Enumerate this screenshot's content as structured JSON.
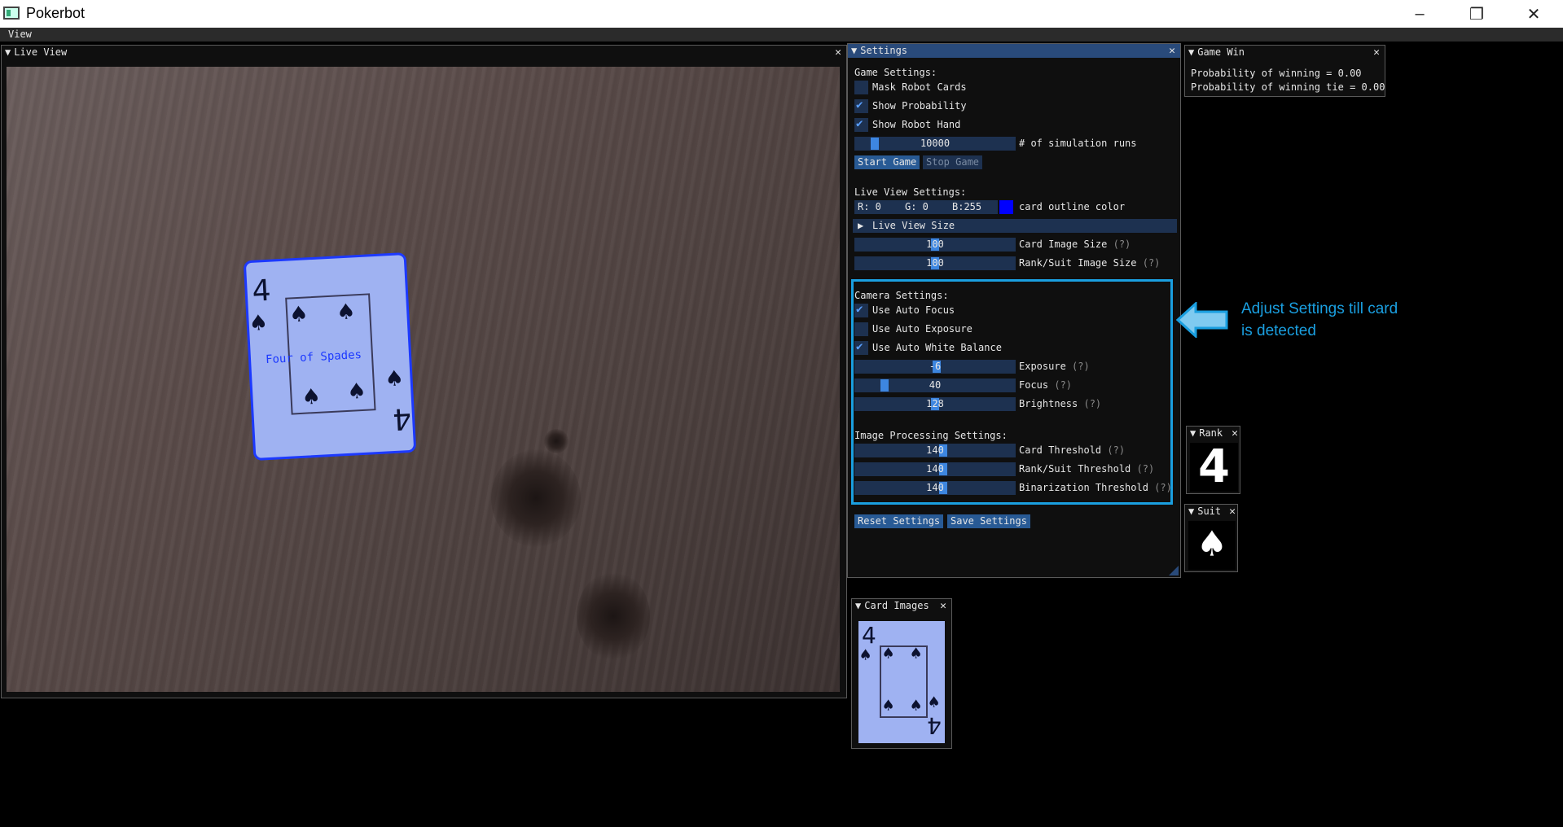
{
  "window": {
    "title": "Pokerbot",
    "minimize": "–",
    "restore": "❐",
    "close": "✕"
  },
  "menu": {
    "view": "View"
  },
  "live_view": {
    "title": "Live View",
    "overlay_text": "Four of Spades"
  },
  "settings": {
    "title": "Settings",
    "game_settings_label": "Game Settings:",
    "mask_robot_cards": {
      "label": "Mask Robot Cards",
      "checked": false
    },
    "show_probability": {
      "label": "Show Probability",
      "checked": true
    },
    "show_robot_hand": {
      "label": "Show Robot Hand",
      "checked": true
    },
    "simulation_runs": {
      "value": "10000",
      "label": "# of simulation runs"
    },
    "start_game": "Start Game",
    "stop_game": "Stop Game",
    "live_view_settings_label": "Live View Settings:",
    "color_r": "R:  0",
    "color_g": "G:  0",
    "color_b": "B:255",
    "card_outline_color_label": "card outline color",
    "outline_color": "#0000ff",
    "live_view_size_header": "Live View Size",
    "card_image_size": {
      "value": "100",
      "label": "Card Image Size",
      "help": "(?)"
    },
    "rank_suit_image_size": {
      "value": "100",
      "label": "Rank/Suit Image Size",
      "help": "(?)"
    },
    "camera_settings_label": "Camera Settings:",
    "use_auto_focus": {
      "label": "Use Auto Focus",
      "checked": true
    },
    "use_auto_exposure": {
      "label": "Use Auto Exposure",
      "checked": false
    },
    "use_auto_white_balance": {
      "label": "Use Auto White Balance",
      "checked": true
    },
    "exposure": {
      "value": "-6",
      "label": "Exposure",
      "help": "(?)"
    },
    "focus": {
      "value": "40",
      "label": "Focus",
      "help": "(?)"
    },
    "brightness": {
      "value": "128",
      "label": "Brightness",
      "help": "(?)"
    },
    "image_processing_label": "Image Processing Settings:",
    "card_threshold": {
      "value": "140",
      "label": "Card Threshold",
      "help": "(?)"
    },
    "rank_suit_threshold": {
      "value": "140",
      "label": "Rank/Suit Threshold",
      "help": "(?)"
    },
    "binarization_threshold": {
      "value": "140",
      "label": "Binarization Threshold",
      "help": "(?)"
    },
    "reset_settings": "Reset Settings",
    "save_settings": "Save Settings"
  },
  "annotation": {
    "text_line1": "Adjust Settings till card",
    "text_line2": "is detected",
    "color": "#1a9fe0"
  },
  "game_win": {
    "title": "Game Win",
    "prob_win": "Probability of winning = 0.00",
    "prob_tie": "Probability of winning tie = 0.00"
  },
  "rank_window": {
    "title": "Rank",
    "rank": "4"
  },
  "suit_window": {
    "title": "Suit",
    "suit": "♠"
  },
  "card_images_window": {
    "title": "Card Images",
    "rank": "4"
  }
}
